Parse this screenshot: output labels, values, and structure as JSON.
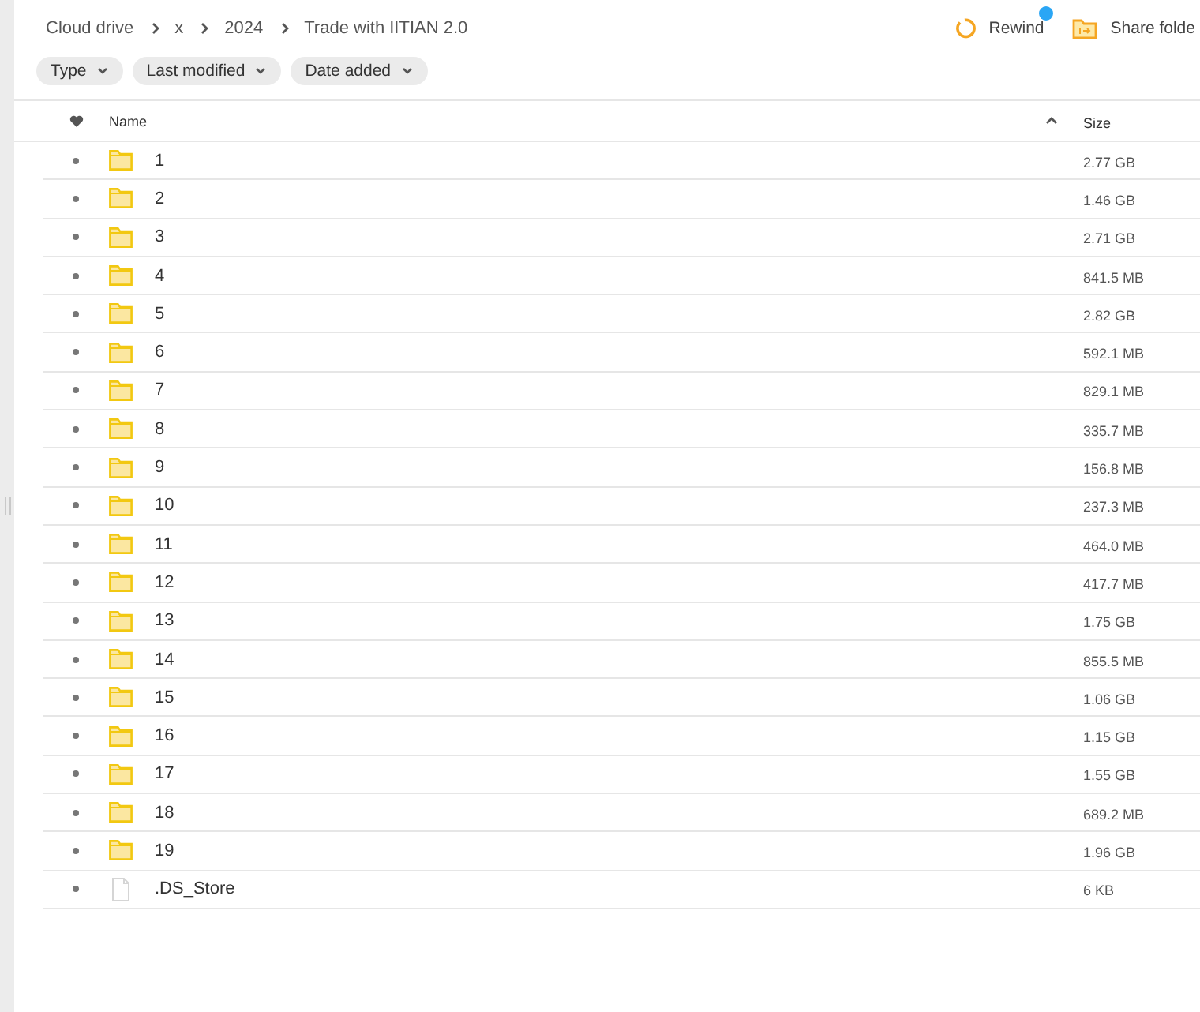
{
  "breadcrumb": [
    "Cloud drive",
    "x",
    "2024",
    "Trade with IITIAN 2.0"
  ],
  "actions": [
    {
      "label": "Rewind",
      "kind": "rewind",
      "notification": true
    },
    {
      "label": "Share folde",
      "kind": "share",
      "notification": false
    }
  ],
  "filters": [
    "Type",
    "Last modified",
    "Date added"
  ],
  "table": {
    "columns": [
      {
        "kind": "favorite"
      },
      {
        "kind": "name",
        "label": "Name",
        "sorted_ascending": true
      },
      {
        "kind": "size",
        "label": "Size"
      }
    ],
    "rows": [
      {
        "kind": "folder",
        "name": "1",
        "size": "2.77 GB",
        "favorite": false
      },
      {
        "kind": "folder",
        "name": "2",
        "size": "1.46 GB",
        "favorite": false
      },
      {
        "kind": "folder",
        "name": "3",
        "size": "2.71 GB",
        "favorite": false
      },
      {
        "kind": "folder",
        "name": "4",
        "size": "841.5 MB",
        "favorite": false
      },
      {
        "kind": "folder",
        "name": "5",
        "size": "2.82 GB",
        "favorite": false
      },
      {
        "kind": "folder",
        "name": "6",
        "size": "592.1 MB",
        "favorite": false
      },
      {
        "kind": "folder",
        "name": "7",
        "size": "829.1 MB",
        "favorite": false
      },
      {
        "kind": "folder",
        "name": "8",
        "size": "335.7 MB",
        "favorite": false
      },
      {
        "kind": "folder",
        "name": "9",
        "size": "156.8 MB",
        "favorite": false
      },
      {
        "kind": "folder",
        "name": "10",
        "size": "237.3 MB",
        "favorite": false
      },
      {
        "kind": "folder",
        "name": "11",
        "size": "464.0 MB",
        "favorite": false
      },
      {
        "kind": "folder",
        "name": "12",
        "size": "417.7 MB",
        "favorite": false
      },
      {
        "kind": "folder",
        "name": "13",
        "size": "1.75 GB",
        "favorite": false
      },
      {
        "kind": "folder",
        "name": "14",
        "size": "855.5 MB",
        "favorite": false
      },
      {
        "kind": "folder",
        "name": "15",
        "size": "1.06 GB",
        "favorite": false
      },
      {
        "kind": "folder",
        "name": "16",
        "size": "1.15 GB",
        "favorite": false
      },
      {
        "kind": "folder",
        "name": "17",
        "size": "1.55 GB",
        "favorite": false
      },
      {
        "kind": "folder",
        "name": "18",
        "size": "689.2 MB",
        "favorite": false
      },
      {
        "kind": "folder",
        "name": "19",
        "size": "1.96 GB",
        "favorite": false
      },
      {
        "kind": "file",
        "name": ".DS_Store",
        "size": "6 KB",
        "favorite": false
      }
    ]
  }
}
